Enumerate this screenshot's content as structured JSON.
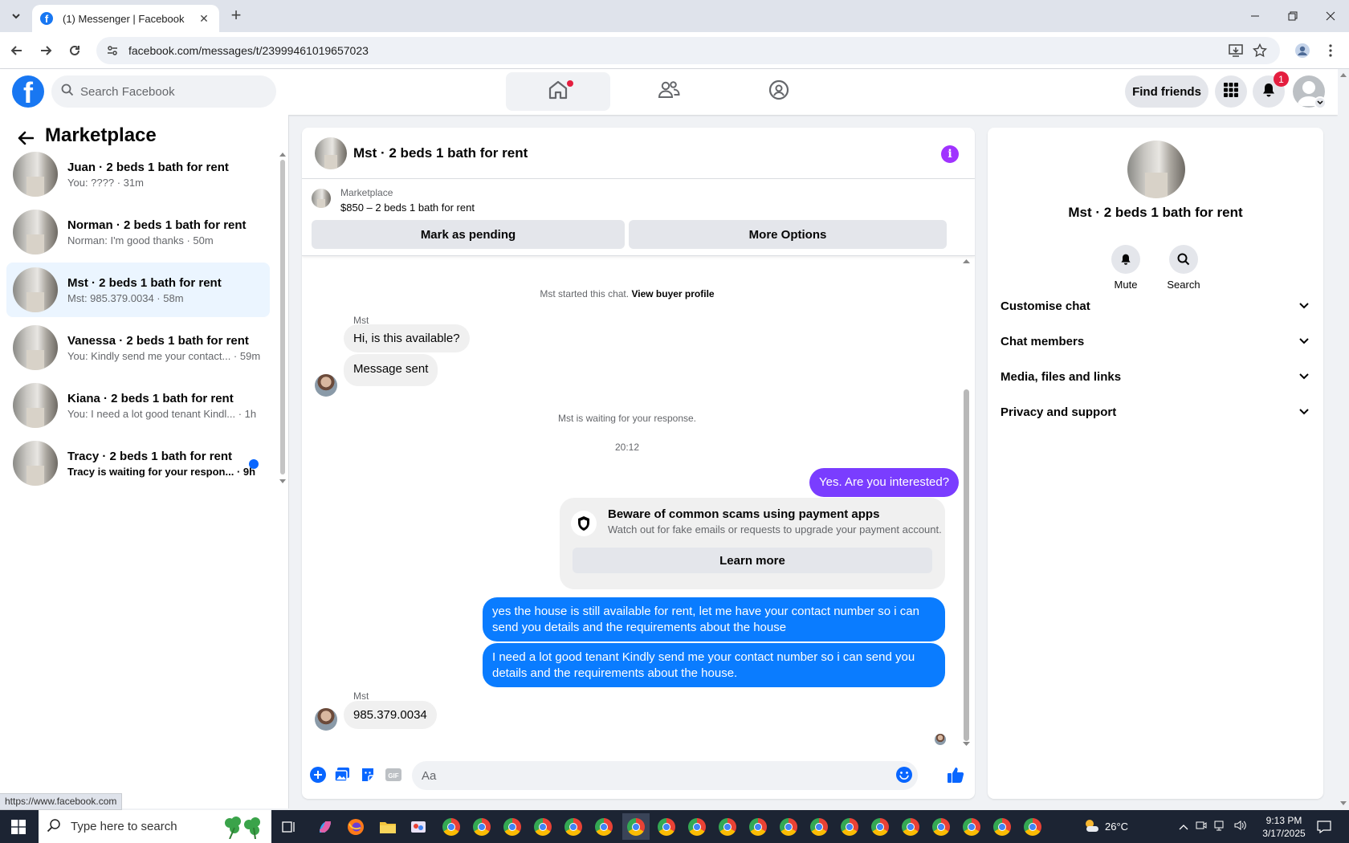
{
  "browser": {
    "tab_title": "(1) Messenger | Facebook",
    "url": "facebook.com/messages/t/23999461019657023",
    "status_url": "https://www.facebook.com"
  },
  "fb": {
    "search_placeholder": "Search Facebook",
    "find_friends": "Find friends",
    "notification_count": "1"
  },
  "sidebar": {
    "title": "Marketplace",
    "conversations": [
      {
        "name": "Juan · 2 beds 1 bath for rent",
        "preview": "You: ???? · 31m",
        "active": false,
        "unread": false
      },
      {
        "name": "Norman · 2 beds 1 bath for rent",
        "preview": "Norman: I'm good thanks · 50m",
        "active": false,
        "unread": false
      },
      {
        "name": "Mst · 2 beds 1 bath for rent",
        "preview": "Mst: 985.379.0034 · 58m",
        "active": true,
        "unread": false
      },
      {
        "name": "Vanessa · 2 beds 1 bath for rent",
        "preview": "You: Kindly send me your contact... · 59m",
        "active": false,
        "unread": false
      },
      {
        "name": "Kiana · 2 beds 1 bath for rent",
        "preview": "You: I need a lot good tenant Kindl... · 1h",
        "active": false,
        "unread": false
      },
      {
        "name": "Tracy · 2 beds 1 bath for rent",
        "preview": "Tracy is waiting for your respon... · 9h",
        "active": false,
        "unread": true
      }
    ]
  },
  "chat": {
    "title": "Mst · 2 beds 1 bath for rent",
    "marketplace_label": "Marketplace",
    "listing": "$850 – 2 beds 1 bath for rent",
    "mark_pending": "Mark as pending",
    "more_options": "More Options",
    "started_text": "Mst started this chat.",
    "view_profile": "View buyer profile",
    "sender1": "Mst",
    "msg_in_1": "Hi, is this available?",
    "msg_in_2": "Message sent",
    "waiting": "Mst is waiting for your response.",
    "time": "20:12",
    "msg_out_1": "Yes. Are you interested?",
    "scam_title": "Beware of common scams using payment apps",
    "scam_sub": "Watch out for fake emails or requests to upgrade your payment account.",
    "learn_more": "Learn more",
    "msg_out_2": "yes the house is still available for rent, let me have your contact number so i can send you details and the requirements about the house",
    "msg_out_3": "I need a lot good tenant Kindly send me your contact number so i can send you details and the requirements about the house.",
    "sender2": "Mst",
    "msg_in_3": "985.379.0034",
    "composer_placeholder": "Aa"
  },
  "info_panel": {
    "name": "Mst · 2 beds 1 bath for rent",
    "mute": "Mute",
    "search": "Search",
    "sections": [
      "Customise chat",
      "Chat members",
      "Media, files and links",
      "Privacy and support"
    ]
  },
  "taskbar": {
    "search_placeholder": "Type here to search",
    "temperature": "26°C",
    "time": "9:13 PM",
    "date": "3/17/2025"
  },
  "colors": {
    "fb_blue": "#1877f2",
    "outgoing_bubble": "#0a7cff",
    "outgoing_bubble_first": "#7a3dff",
    "active_conversation": "#ebf5ff"
  }
}
